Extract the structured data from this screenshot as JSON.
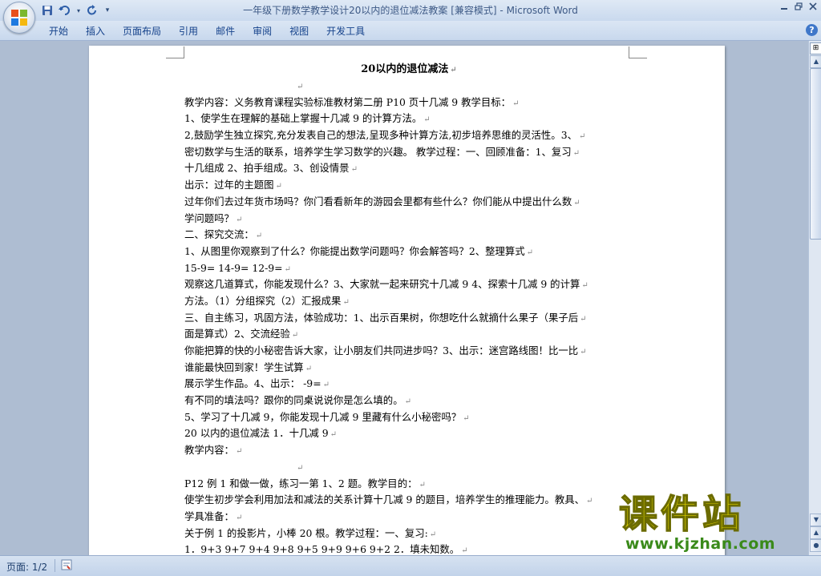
{
  "window": {
    "title": "一年级下册数学教学设计20以内的退位减法教案 [兼容模式] - Microsoft Word"
  },
  "quick_access": {
    "icons": [
      "save-icon",
      "undo-icon",
      "redo-icon",
      "customize-icon"
    ]
  },
  "ribbon": {
    "tabs": [
      "开始",
      "插入",
      "页面布局",
      "引用",
      "邮件",
      "审阅",
      "视图",
      "开发工具"
    ]
  },
  "document": {
    "heading": "20以内的退位减法",
    "lines": [
      "",
      "教学内容：义务教育课程实验标准教材第二册 P10 页十几减 9 教学目标：",
      "1、使学生在理解的基础上掌握十几减 9 的计算方法。",
      "2,鼓励学生独立探究,充分发表自己的想法,呈现多种计算方法,初步培养思维的灵活性。3、",
      "密切数学与生活的联系，培养学生学习数学的兴趣。 教学过程：一、回顾准备：1、复习",
      "十几组成 2、拍手组成。3、创设情景",
      "出示：过年的主题图",
      "过年你们去过年货市场吗？你门看看新年的游园会里都有些什么？你们能从中提出什么数",
      "学问题吗？",
      "    二、探究交流：",
      "1、从图里你观察到了什么？你能提出数学问题吗？你会解答吗？2、整理算式",
      "15-9=  14-9=  12-9=",
      "观察这几道算式，你能发现什么？3、大家就一起来研究十几减 9 4、探索十几减 9 的计算",
      "方法。（1）分组探究（2）汇报成果",
      "三、自主练习，巩固方法，体验成功：1、出示百果树，你想吃什么就摘什么果子（果子后",
      "面是算式）2、交流经验",
      "你能把算的快的小秘密告诉大家，让小朋友们共同进步吗？3、出示：迷宫路线图！比一比",
      "谁能最快回到家！学生试算",
      "展示学生作品。4、出示：  -9=",
      "有不同的填法吗？跟你的同桌说说你是怎么填的。",
      "5、学习了十几减 9，你能发现十几减 9 里藏有什么小秘密吗？",
      "20 以内的退位减法 1．十几减 9",
      "教学内容：",
      "",
      "P12 例 1 和做一做，练习一第 1、2 题。教学目的：",
      "使学生初步学会利用加法和减法的关系计算十几减 9 的题目，培养学生的推理能力。教具、",
      "学具准备：",
      "关于例 1 的投影片，小棒 20 根。教学过程：一、复习:",
      "1．9+3  9+7  9+4  9+8      9+5  9+9  9+6  9+2 2．填未知数。"
    ],
    "paragraph_mark": "↵"
  },
  "watermark": {
    "brand": "课件站",
    "url": "www.kjzhan.com"
  },
  "status": {
    "page": "页面: 1/2"
  }
}
